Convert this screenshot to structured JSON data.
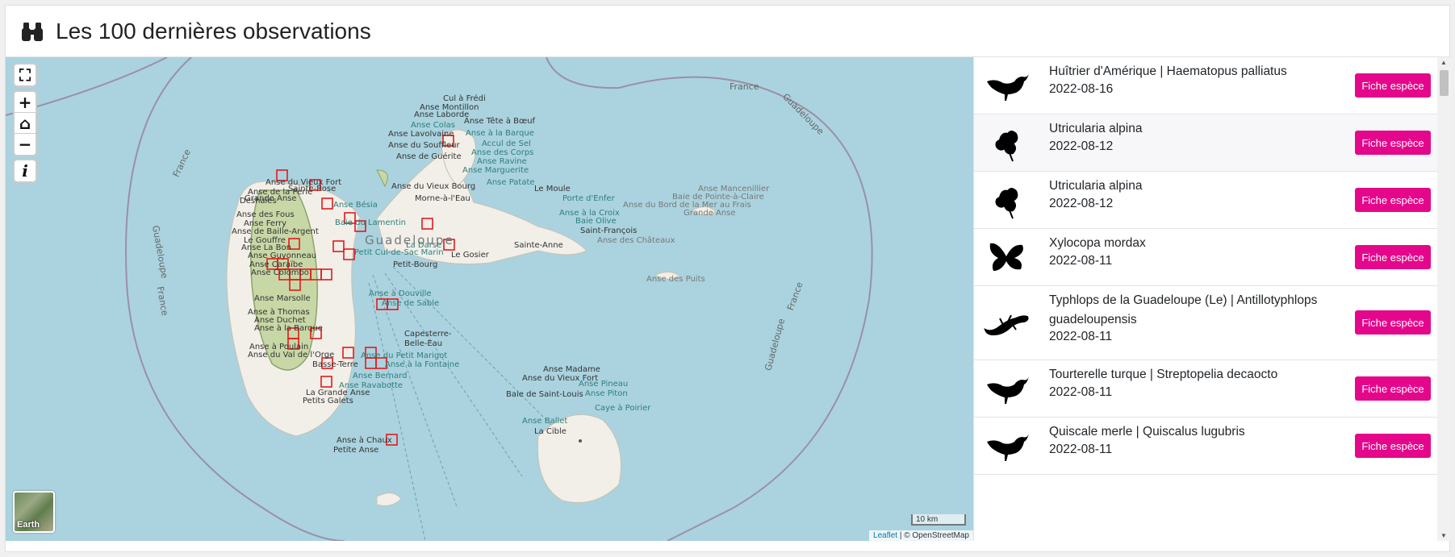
{
  "header": {
    "title": "Les 100 dernières observations",
    "icon": "binoculars-icon"
  },
  "map": {
    "controls": {
      "fullscreen": "⛶",
      "zoom_in": "+",
      "home": "⌂",
      "zoom_out": "−",
      "info": "i"
    },
    "basemap_label": "Earth",
    "scale_label": "10 km",
    "attribution": {
      "leaflet": "Leaflet",
      "sep": " | © ",
      "osm": "OpenStreetMap"
    },
    "labels": {
      "france1": "France",
      "france2": "France",
      "france3": "France",
      "france4": "France",
      "guadeloupe1": "Guadeloupe",
      "guadeloupe2": "Guadeloupe",
      "guadeloupe3": "Guadeloupe",
      "guadeloupe_main": "Guadeloupe",
      "deshaies": "Deshaies",
      "sainte_rose": "Sainte-Rose",
      "morne": "Morne-à-l'Eau",
      "le_moule": "Le Moule",
      "petit_bourg": "Petit-Bourg",
      "le_gosier": "Le Gosier",
      "sainte_anne": "Sainte-Anne",
      "saint_francois": "Saint-François",
      "capesterre": "Capesterre-",
      "belle_eau": "Belle-Eau",
      "basse_terre": "Basse-Terre",
      "anse_des_puits": "Anse des Puits",
      "anse_mancenillier": "Anse Mancenillier",
      "baie_pointe": "Baie de Pointe-à-Claire",
      "anse_bord": "Anse du Bord de la Mer au Frais",
      "grande_anse_ld": "Grande Anse",
      "anse_chateaux": "Anse des Châteaux",
      "anse_madame": "Anse Madame",
      "anse_vieux_fort_mg": "Anse du Vieux Fort",
      "anse_pineau": "Anse Pineau",
      "anse_piton": "Anse Piton",
      "baie_st_louis": "Baie de Saint-Louis",
      "caye_poirier": "Caye à Poirier",
      "anse_ballet": "Anse Ballet",
      "la_cible": "La Cible",
      "anse_chaux": "Anse à Chaux",
      "petite_anse": "Petite Anse",
      "cul_de_sac": "Petit Cul-de-Sac Marin",
      "anse_vieux_bourg": "Anse du Vieux Bourg",
      "porte_enfer": "Porte d'Enfer",
      "anse_a_la_croix": "Anse à la Croix",
      "baie_olive": "Baie Olive",
      "anse_patate": "Anse Patate",
      "la_darse": "La Darse",
      "anse_douville": "Anse à Douville",
      "anse_sable": "Anse de Sable",
      "anse_bernard": "Anse Bernard",
      "anse_ravabotte": "Anse Ravabotte",
      "grande_anse_bt": "La Grande Anse",
      "petits_galets": "Petits Galets",
      "anse_petit_marigot": "Anse du Petit Marigot",
      "anse_fontaine": "Anse à la Fontaine",
      "cul_a_fredi": "Cul à Frédi",
      "anse_montillon": "Anse Montillon",
      "anse_laborde": "Anse Laborde",
      "anse_colas": "Anse Colas",
      "anse_tete": "Anse Tête à Bœuf",
      "anse_lavolvaine": "Anse Lavolvaine",
      "anse_barque_gt": "Anse à la Barque",
      "anse_souffleur": "Anse du Souffleur",
      "accul_sel": "Accul de Sel",
      "anse_guerite": "Anse de Guérite",
      "anse_corps": "Anse des Corps",
      "anse_ravine": "Anse Ravine",
      "anse_marguerite": "Anse Marguerite",
      "anse_vieux_fort_bt": "Anse du Vieux Fort",
      "anse_perle": "Anse de la Perle",
      "grande_anse_bt2": "Grande Anse",
      "anse_fous": "Anse des Fous",
      "anse_ferry": "Anse Ferry",
      "anse_baille": "Anse de Baille-Argent",
      "le_gouffre": "Le Gouffre",
      "anse_la_bon": "Anse La Bon",
      "anse_guyonneau": "Anse Guyonneau",
      "anse_caraibe": "Anse Caraïbe",
      "anse_colombo": "Anse Colombo",
      "anse_thomas": "Anse à Thomas",
      "anse_duchet": "Anse Duchet",
      "anse_a_barque_bt": "Anse à la Barque",
      "anse_poulain": "Anse à Poulain",
      "anse_val_orge": "Anse du Val de l'Orge",
      "anse_marsolle": "Anse Marsolle",
      "anse_besia": "Anse Bésia",
      "baie_lamentin": "Baie du Lamentin"
    }
  },
  "observations": [
    {
      "name": "Huîtrier d'Amérique | Haematopus palliatus",
      "date": "2022-08-16",
      "icon": "bird-silhouette-icon",
      "button": "Fiche espèce"
    },
    {
      "name": "Utricularia alpina",
      "date": "2022-08-12",
      "icon": "flower-silhouette-icon",
      "button": "Fiche espèce"
    },
    {
      "name": "Utricularia alpina",
      "date": "2022-08-12",
      "icon": "flower-silhouette-icon",
      "button": "Fiche espèce"
    },
    {
      "name": "Xylocopa mordax",
      "date": "2022-08-11",
      "icon": "butterfly-silhouette-icon",
      "button": "Fiche espèce"
    },
    {
      "name": "Typhlops de la Guadeloupe (Le) | Antillotyphlops guadeloupensis",
      "date": "2022-08-11",
      "icon": "lizard-silhouette-icon",
      "button": "Fiche espèce"
    },
    {
      "name": "Tourterelle turque | Streptopelia decaocto",
      "date": "2022-08-11",
      "icon": "bird-silhouette-icon",
      "button": "Fiche espèce"
    },
    {
      "name": "Quiscale merle | Quiscalus lugubris",
      "date": "2022-08-11",
      "icon": "bird-silhouette-icon",
      "button": "Fiche espèce"
    }
  ],
  "colors": {
    "sea": "#aad3df",
    "land": "#f2efe9",
    "accent": "#e5078b",
    "marker": "#e31a1c",
    "park": "#c8d7a6"
  }
}
